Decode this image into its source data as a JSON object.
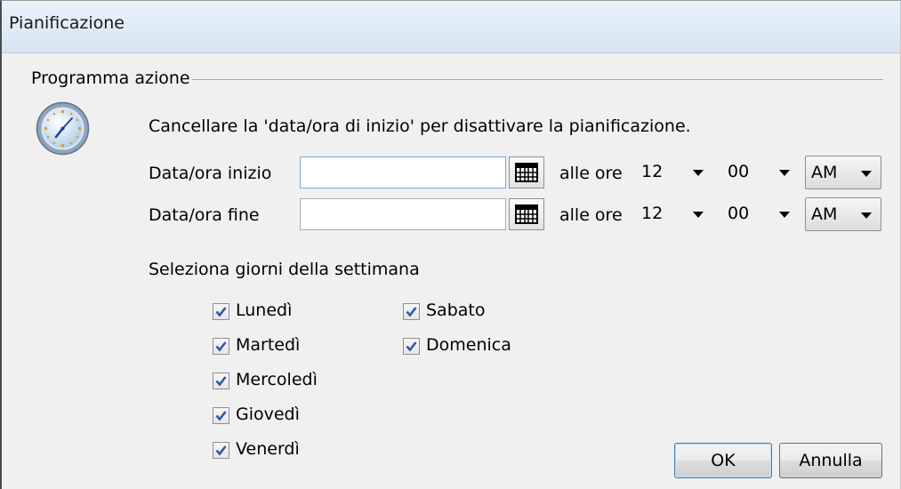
{
  "window": {
    "title": "Pianificazione"
  },
  "group": {
    "legend": "Programma azione"
  },
  "info_text": "Cancellare la 'data/ora di inizio' per disattivare la pianificazione.",
  "start": {
    "label": "Data/ora inizio",
    "value": "",
    "at_label": "alle ore",
    "hour": "12",
    "minute": "00",
    "ampm": "AM"
  },
  "end": {
    "label": "Data/ora fine",
    "value": "",
    "at_label": "alle ore",
    "hour": "12",
    "minute": "00",
    "ampm": "AM"
  },
  "days_heading": "Seleziona giorni della settimana",
  "days": [
    {
      "label": "Lunedì",
      "checked": true
    },
    {
      "label": "Martedì",
      "checked": true
    },
    {
      "label": "Mercoledì",
      "checked": true
    },
    {
      "label": "Giovedì",
      "checked": true
    },
    {
      "label": "Venerdì",
      "checked": true
    },
    {
      "label": "Sabato",
      "checked": true
    },
    {
      "label": "Domenica",
      "checked": true
    }
  ],
  "buttons": {
    "ok": "OK",
    "cancel": "Annulla"
  },
  "icons": {
    "clock": "clock-icon",
    "calendar": "calendar-icon",
    "check": "checkmark-icon"
  },
  "colors": {
    "title_bar": "#d6e5f3",
    "check": "#2a5ba8",
    "default_button_border": "#3c7fb1"
  }
}
